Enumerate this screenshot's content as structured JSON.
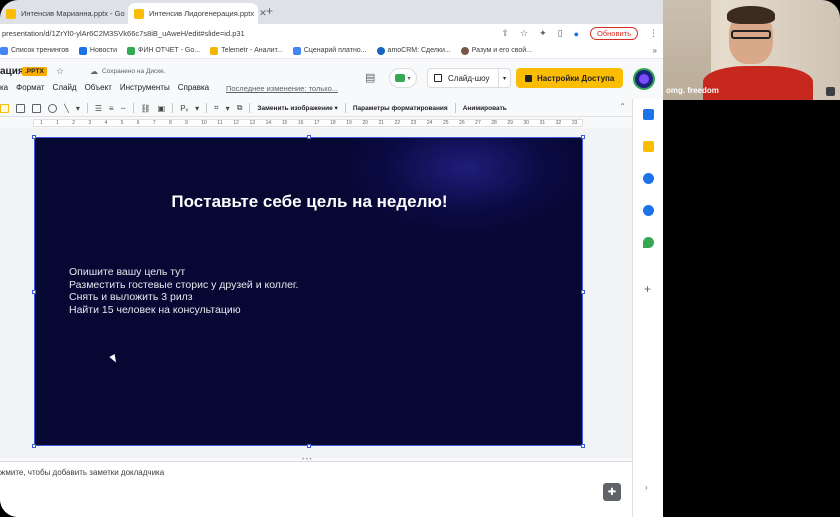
{
  "browser": {
    "tabs": [
      {
        "title": "Интенсив Марианна.pptx - Go",
        "active": false,
        "icon_color": "#fbbc04"
      },
      {
        "title": "Интенсив Лидогенерация.pptx",
        "active": true,
        "icon_color": "#fbbc04"
      }
    ],
    "url": "presentation/d/1ZrYl0-ylAr6C2M3SVk66c7s8iB_uAweH/edit#slide=id.p31",
    "update_label": "Обновить",
    "bookmarks": [
      {
        "label": "Список тренингов",
        "color": "#4285f4"
      },
      {
        "label": "Новости",
        "color": "#1a73e8"
      },
      {
        "label": "ФИН ОТЧЕТ - Go...",
        "color": "#34a853"
      },
      {
        "label": "Telemetr - Аналит...",
        "color": "#f4b400"
      },
      {
        "label": "Сценарий платно...",
        "color": "#4285f4"
      },
      {
        "label": "amoCRM: Сделки...",
        "color": "#1565c0"
      },
      {
        "label": "Разум и его свой...",
        "color": "#795548"
      }
    ],
    "bookmarks_more": "»"
  },
  "doc": {
    "title": "ация",
    "badge": ".PPTX",
    "saved_status": "Сохранено на Диске.",
    "menu": [
      "ка",
      "Формат",
      "Слайд",
      "Объект",
      "Инструменты",
      "Справка"
    ],
    "last_change": "Последнее изменение: только...",
    "slideshow_label": "Слайд-шоу",
    "access_label": "Настройки Доступа"
  },
  "toolbar": {
    "replace_image": "Заменить изображение ▾",
    "format_options": "Параметры форматирования",
    "animate": "Анимировать"
  },
  "ruler": {
    "numbers": [
      "1",
      "1",
      "2",
      "3",
      "4",
      "5",
      "6",
      "7",
      "8",
      "9",
      "10",
      "11",
      "12",
      "13",
      "14",
      "15",
      "16",
      "17",
      "18",
      "19",
      "20",
      "21",
      "22",
      "23",
      "24",
      "25",
      "26",
      "27",
      "28",
      "29",
      "30",
      "31",
      "32",
      "33"
    ]
  },
  "slide": {
    "title": "Поставьте себе цель на неделю!",
    "lines": [
      "Опишите вашу цель тут",
      "Разместить гостевые сторис у друзей и коллег.",
      "Снять и выложить 3 рилз",
      "Найти 15 человек на консультацию"
    ]
  },
  "notes": {
    "placeholder": "жмите, чтобы добавить заметки докладчика"
  },
  "webcam": {
    "name": "omg. freedom"
  }
}
